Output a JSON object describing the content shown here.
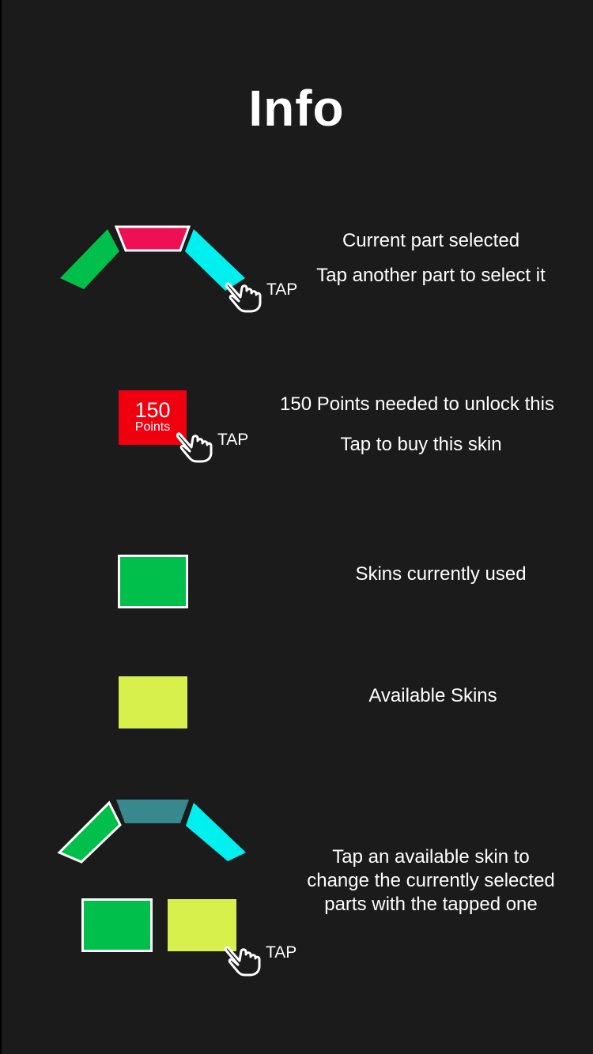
{
  "title": "Info",
  "colors": {
    "background": "#1b1b1b",
    "selected_part": "#ee0f55",
    "part_green": "#00c04b",
    "part_cyan": "#00f0f0",
    "part_teal": "#37898d",
    "price_tag": "#f0000f",
    "available_skin": "#d7f04c"
  },
  "sections": {
    "parts": {
      "captions": [
        "Current part selected",
        "Tap another part to select it"
      ],
      "tap": "TAP"
    },
    "price": {
      "value": "150",
      "unit": "Points",
      "captions": [
        "150 Points needed to unlock this",
        "Tap to buy this skin"
      ],
      "tap": "TAP"
    },
    "used": {
      "caption": "Skins currently used"
    },
    "available": {
      "caption": "Available Skins"
    },
    "change": {
      "caption_lines": [
        "Tap an available skin to",
        "change the currently selected",
        "parts with the tapped one"
      ],
      "tap": "TAP"
    }
  },
  "icons": {
    "hand": "hand-pointer-icon"
  }
}
